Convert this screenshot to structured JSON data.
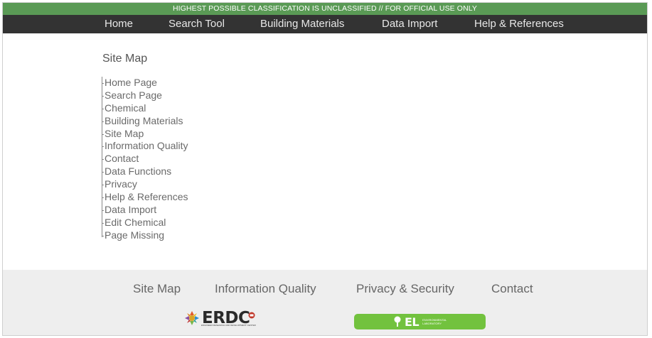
{
  "classification_banner": "HIGHEST POSSIBLE CLASSIFICATION IS UNCLASSIFIED // FOR OFFICIAL USE ONLY",
  "nav": {
    "items": [
      {
        "label": "Home"
      },
      {
        "label": "Search Tool"
      },
      {
        "label": "Building Materials"
      },
      {
        "label": "Data Import"
      },
      {
        "label": "Help & References"
      }
    ]
  },
  "main": {
    "title": "Site Map",
    "tree": [
      {
        "label": "Home Page"
      },
      {
        "label": "Search Page"
      },
      {
        "label": "Chemical"
      },
      {
        "label": "Building Materials"
      },
      {
        "label": "Site Map"
      },
      {
        "label": "Information Quality"
      },
      {
        "label": "Contact"
      },
      {
        "label": "Data Functions"
      },
      {
        "label": "Privacy"
      },
      {
        "label": "Help & References"
      },
      {
        "label": "Data Import"
      },
      {
        "label": "Edit Chemical"
      },
      {
        "label": "Page Missing"
      }
    ]
  },
  "footer": {
    "links": [
      {
        "label": "Site Map"
      },
      {
        "label": "Information Quality"
      },
      {
        "label": "Privacy & Security"
      },
      {
        "label": "Contact"
      }
    ],
    "erdc_logo": {
      "text": "ERDC",
      "subtext": "ENGINEER RESEARCH AND DEVELOPMENT CENTER",
      "icon": "erdc-castle-icon"
    },
    "el_logo": {
      "text": "EL",
      "subtext": "ENVIRONMENTAL LABORATORY",
      "icon": "tree-icon"
    }
  },
  "colors": {
    "classification_bg": "#5a9a55",
    "nav_bg": "#333333",
    "footer_bg": "#eeeeee",
    "el_green": "#72c23e"
  }
}
